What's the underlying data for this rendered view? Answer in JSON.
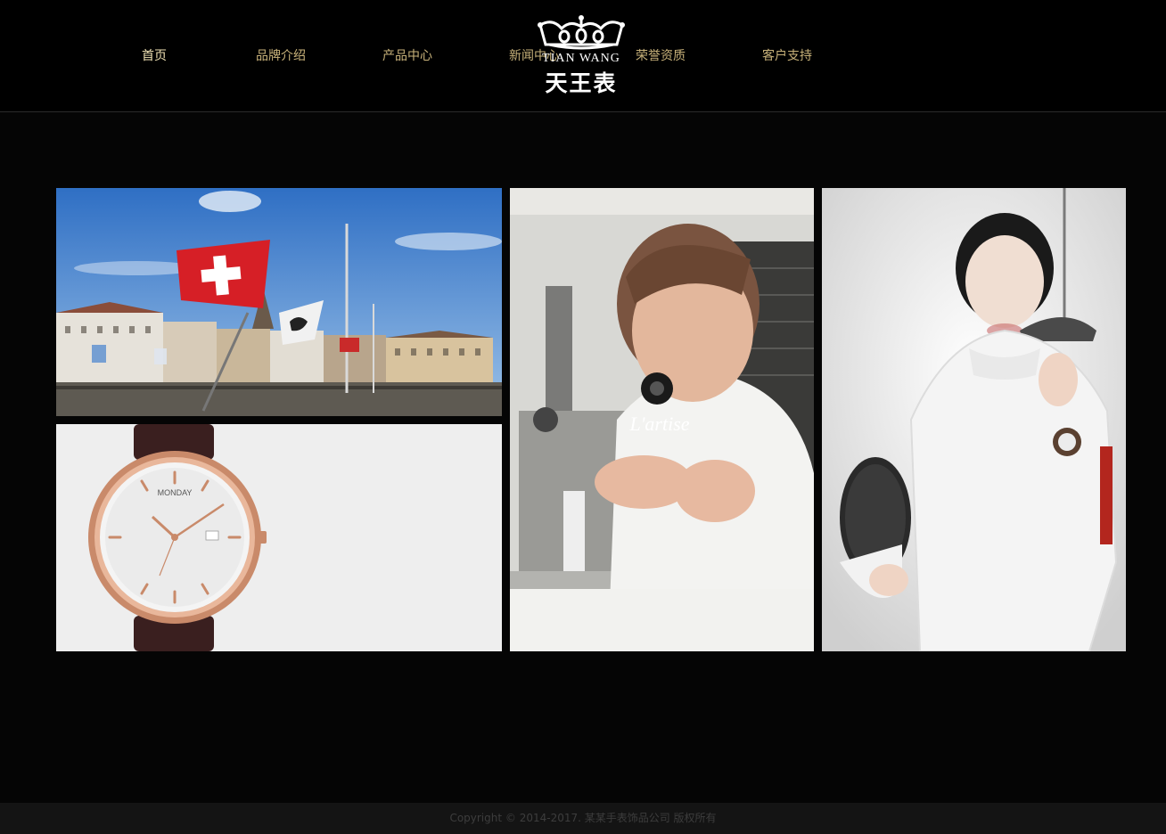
{
  "nav": {
    "items": [
      {
        "label": "首页",
        "active": true
      },
      {
        "label": "品牌介绍"
      },
      {
        "label": "产品中心"
      },
      {
        "label": "新闻中心"
      },
      {
        "label": "荣誉资质"
      },
      {
        "label": "客户支持"
      }
    ]
  },
  "logo": {
    "en": "TIAN WANG",
    "cn": "天王表",
    "icon": "crown-icon"
  },
  "gallery": {
    "craftsman_caption": "L'artise",
    "watch_dial_text": "MONDAY"
  },
  "footer": {
    "copyright": "Copyright © 2014-2017. 某某手表饰品公司 版权所有"
  },
  "colors": {
    "background": "#050505",
    "nav_text": "#c8b27a",
    "nav_active": "#f0e2b4",
    "footer_bg": "#141414",
    "footer_text": "#3d3d3d"
  }
}
